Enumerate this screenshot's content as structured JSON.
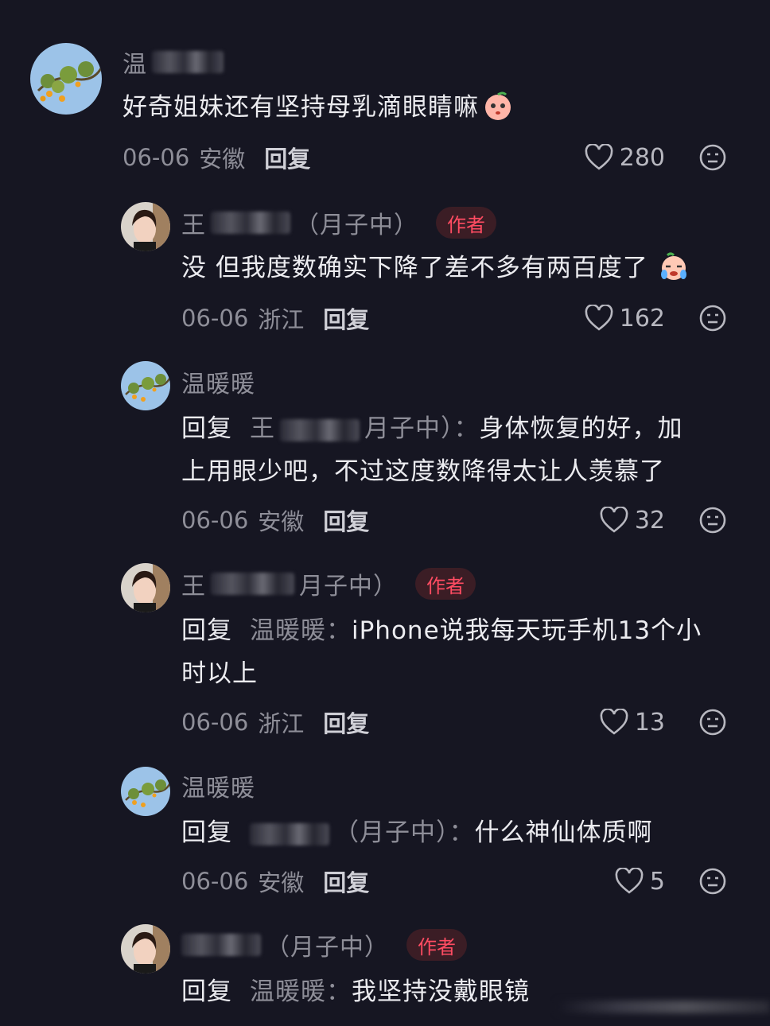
{
  "comments": [
    {
      "name": "温",
      "text": "好奇姐妹还有坚持母乳滴眼睛嘛",
      "date": "06-06",
      "location": "安徽",
      "reply_label": "回复",
      "likes": "280"
    },
    {
      "name": "王",
      "name_suffix": "（月子中）",
      "badge": "作者",
      "text": "没 但我度数确实下降了差不多有两百度了",
      "date": "06-06",
      "location": "浙江",
      "reply_label": "回复",
      "likes": "162"
    },
    {
      "name": "温暖暖",
      "prefix": "回复",
      "target_name": "王",
      "target_suffix": "月子中）：",
      "text_line1": "身体恢复的好，加",
      "text_line2": "上用眼少吧，不过这度数降得太让人羡慕了",
      "date": "06-06",
      "location": "安徽",
      "reply_label": "回复",
      "likes": "32"
    },
    {
      "name": "王",
      "name_suffix": "月子中）",
      "badge": "作者",
      "prefix": "回复",
      "target_name": "温暖暖：",
      "text_line1": "iPhone说我每天玩手机13个小",
      "text_line2": "时以上",
      "date": "06-06",
      "location": "浙江",
      "reply_label": "回复",
      "likes": "13"
    },
    {
      "name": "温暖暖",
      "prefix": "回复",
      "target_suffix": "（月子中）：",
      "text": "什么神仙体质啊",
      "date": "06-06",
      "location": "安徽",
      "reply_label": "回复",
      "likes": "5"
    },
    {
      "name_suffix": "（月子中）",
      "badge": "作者",
      "prefix": "回复",
      "target_name": "温暖暖：",
      "text": "我坚持没戴眼镜"
    }
  ],
  "icons": {
    "like": "heart-outline-icon",
    "dislike": "neutral-face-icon",
    "emoji_peach": "peach-face-emoji",
    "emoji_cry": "crying-face-emoji"
  },
  "colors": {
    "background": "#161622",
    "badge_bg": "#3b1d25",
    "badge_text": "#ff4c62",
    "muted_text": "#8e8e98"
  }
}
